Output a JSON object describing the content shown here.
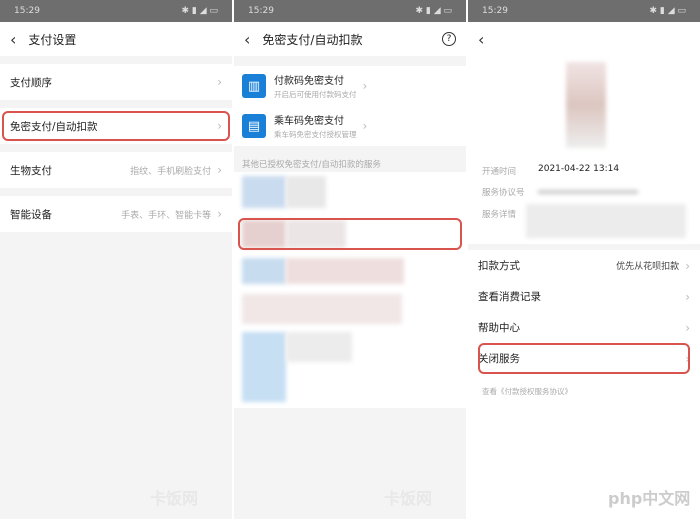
{
  "time": "15:29",
  "p1": {
    "title": "支付设置",
    "items": [
      {
        "label": "支付顺序",
        "value": ""
      },
      {
        "label": "免密支付/自动扣款",
        "value": ""
      },
      {
        "label": "生物支付",
        "value": "指纹、手机刷脸支付"
      },
      {
        "label": "智能设备",
        "value": "手表、手环、智能卡等"
      }
    ],
    "watermark": "卡饭网"
  },
  "p2": {
    "title": "免密支付/自动扣款",
    "help": "?",
    "services": [
      {
        "title": "付款码免密支付",
        "sub": "开启后可使用付款码支付"
      },
      {
        "title": "乘车码免密支付",
        "sub": "乘车码免密支付授权管理"
      }
    ],
    "section": "其他已授权免密支付/自动扣款的服务",
    "watermark": "卡饭网"
  },
  "p3": {
    "open_time_label": "开通时间",
    "open_time": "2021-04-22 13:14",
    "agreement_label": "服务协议号",
    "detail_label": "服务详情",
    "rows": [
      {
        "label": "扣款方式",
        "value": "优先从花呗扣款"
      },
      {
        "label": "查看消费记录",
        "value": ""
      },
      {
        "label": "帮助中心",
        "value": ""
      },
      {
        "label": "关闭服务",
        "value": ""
      }
    ],
    "footer": "查看《付款授权服务协议》",
    "watermark": "php中文网"
  },
  "accent": "#1a7fd6",
  "highlight": "#d9534f"
}
